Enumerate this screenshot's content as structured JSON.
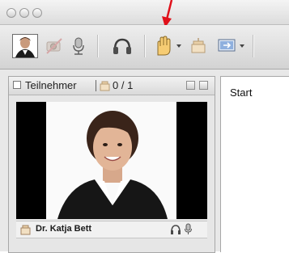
{
  "window": {
    "title_bar": {
      "buttons": [
        "close",
        "minimize",
        "zoom"
      ]
    }
  },
  "toolbar": {
    "items": [
      {
        "icon": "user-avatar-icon",
        "name": "user-avatar-button"
      },
      {
        "icon": "camera-disabled-icon",
        "name": "camera-button"
      },
      {
        "icon": "microphone-icon",
        "name": "microphone-button"
      },
      {
        "icon": "headphones-icon",
        "name": "headphones-button"
      },
      {
        "icon": "raise-hand-icon",
        "name": "raise-hand-button",
        "has_dropdown": true
      },
      {
        "icon": "leave-seat-icon",
        "name": "status-button"
      },
      {
        "icon": "screen-share-icon",
        "name": "screen-share-button",
        "has_dropdown": true
      }
    ],
    "annotation_arrow_color": "#e0101a"
  },
  "participants": {
    "title": "Teilnehmer",
    "count": "0 / 1",
    "user": {
      "name": "Dr. Katja Bett"
    }
  },
  "content": {
    "start_label": "Start"
  }
}
